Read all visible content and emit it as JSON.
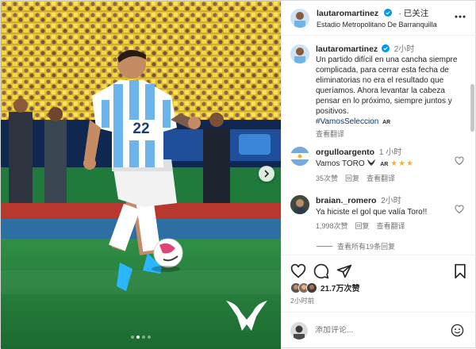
{
  "header": {
    "username": "lautaromartinez",
    "follow_label": "· 已关注",
    "location": "Estadio Metropolitano De Barranquilla"
  },
  "caption": {
    "username": "lautaromartinez",
    "time": "2小时",
    "text": "Un partido difícil en una cancha siempre complicada, para cerrar esta fecha de eliminatorias no era el resultado que queríamos. Ahora levantar la cabeza pensar en lo próximo, siempre juntos y positivos.",
    "hashtag": "#VamosSeleccion",
    "hashtag_suffix": "AR",
    "translate": "查看翻译"
  },
  "comments": [
    {
      "username": "orgulloargento",
      "time": "1 小时",
      "text": "Vamos TORO",
      "flag_text": "AR",
      "stars": "★★★",
      "likes": "35次赞",
      "reply": "回复",
      "translate": "查看翻译"
    },
    {
      "username": "braian._romero",
      "time": "2小时",
      "text": "Ya hiciste el gol que valía Toro!!",
      "likes": "1,998次赞",
      "reply": "回复",
      "translate": "查看翻译"
    }
  ],
  "view_all_replies": "查看所有19条回复",
  "likes_count": "21.7万次赞",
  "posted_time": "2小时前",
  "add_comment_placeholder": "添加评论...",
  "photo": {
    "jersey_number": "22",
    "active_slide": 2,
    "slides": 4
  },
  "colors": {
    "link": "#00376b",
    "muted": "#737373",
    "verified": "#0095f6",
    "pitch": "#1f7a3b"
  }
}
